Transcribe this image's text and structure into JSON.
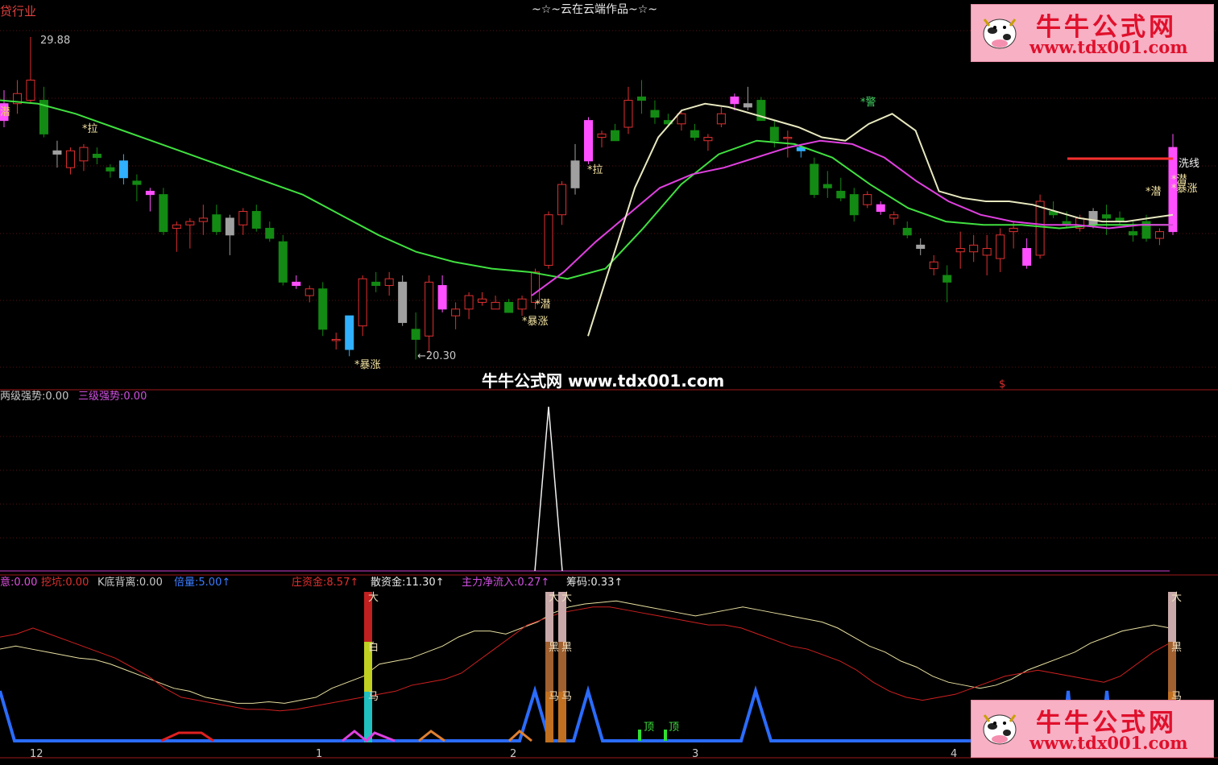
{
  "header": {
    "left_title": "贷行业",
    "center_title": "~☆~云在云端作品~☆~",
    "watermark": "牛牛公式网 www.tdx001.com"
  },
  "logo": {
    "cn": "牛牛公式网",
    "url": "www.tdx001.com"
  },
  "main_panel": {
    "price_high_label": "29.88",
    "price_low_label": "←20.30",
    "dollar_mark": "$",
    "annotations": [
      {
        "id": "qian-left",
        "text": "潜"
      },
      {
        "id": "la-1",
        "text": "*拉"
      },
      {
        "id": "la-2",
        "text": "*拉"
      },
      {
        "id": "baozhang-1",
        "text": "*暴涨"
      },
      {
        "id": "qian-2",
        "text": "*潜"
      },
      {
        "id": "baozhang-2",
        "text": "*暴涨"
      },
      {
        "id": "jing",
        "text": "*警"
      },
      {
        "id": "xixian",
        "text": "洗线"
      },
      {
        "id": "qian-3",
        "text": "*潜"
      },
      {
        "id": "qian-4",
        "text": "*潜"
      },
      {
        "id": "baozhang-3",
        "text": "*暴涨"
      }
    ]
  },
  "indicator1": {
    "items": [
      {
        "label": "两级强势:",
        "value": "0.00",
        "color": "#c8c8c8"
      },
      {
        "label": "三级强势:",
        "value": "0.00",
        "color": "#d050e0"
      }
    ]
  },
  "indicator2": {
    "items": [
      {
        "label": "意:",
        "value": "0.00",
        "color": "#e050e0"
      },
      {
        "label": "挖坑:",
        "value": "0.00",
        "color": "#e03030"
      },
      {
        "label": "K底背离:",
        "value": "0.00",
        "color": "#c8c8c8"
      },
      {
        "label": "倍量:",
        "value": "5.00↑",
        "color": "#3a7cff"
      },
      {
        "label": "庄资金:",
        "value": "8.57↑",
        "color": "#e03030"
      },
      {
        "label": "散资金:",
        "value": "11.30↑",
        "color": "#e8e8e8"
      },
      {
        "label": "主力净流入:",
        "value": "0.27↑",
        "color": "#d050e0"
      },
      {
        "label": "筹码:",
        "value": "0.33↑",
        "color": "#e8e8e8"
      }
    ],
    "bar_tags": [
      "大",
      "白",
      "马",
      "大",
      "大",
      "黑",
      "黑",
      "马",
      "马",
      "大",
      "黑",
      "马"
    ],
    "ding_tags": [
      "顶",
      "顶"
    ]
  },
  "x_axis": {
    "ticks": [
      "12",
      "1",
      "2",
      "3",
      "4"
    ]
  },
  "chart_data": {
    "type": "line",
    "title": "",
    "candles_ohlc": [
      [
        27.9,
        28.3,
        27.2,
        27.4
      ],
      [
        27.9,
        28.6,
        27.6,
        28.2
      ],
      [
        28.0,
        29.88,
        27.9,
        28.6
      ],
      [
        28.0,
        28.4,
        26.9,
        27.0
      ],
      [
        26.5,
        26.8,
        26.0,
        26.4
      ],
      [
        26.0,
        26.6,
        25.8,
        26.5
      ],
      [
        26.2,
        26.7,
        25.9,
        26.6
      ],
      [
        26.4,
        26.6,
        26.1,
        26.3
      ],
      [
        26.0,
        26.1,
        25.7,
        25.9
      ],
      [
        26.2,
        26.4,
        25.5,
        25.7
      ],
      [
        25.6,
        25.8,
        25.0,
        25.5
      ],
      [
        25.3,
        25.4,
        24.7,
        25.2
      ],
      [
        25.2,
        25.4,
        24.0,
        24.1
      ],
      [
        24.2,
        24.4,
        23.5,
        24.3
      ],
      [
        24.3,
        24.5,
        23.6,
        24.4
      ],
      [
        24.4,
        24.9,
        24.0,
        24.5
      ],
      [
        24.6,
        24.9,
        24.0,
        24.1
      ],
      [
        24.0,
        24.6,
        23.4,
        24.5
      ],
      [
        24.3,
        24.8,
        24.0,
        24.7
      ],
      [
        24.7,
        24.9,
        24.1,
        24.2
      ],
      [
        24.2,
        24.4,
        23.8,
        23.9
      ],
      [
        23.8,
        24.0,
        22.5,
        22.6
      ],
      [
        22.6,
        22.8,
        22.4,
        22.5
      ],
      [
        22.2,
        22.5,
        22.0,
        22.4
      ],
      [
        22.4,
        22.6,
        21.0,
        21.2
      ],
      [
        20.9,
        21.1,
        20.6,
        20.9
      ],
      [
        20.6,
        21.6,
        20.4,
        21.6
      ],
      [
        21.3,
        22.8,
        21.0,
        22.7
      ],
      [
        22.6,
        22.9,
        22.3,
        22.5
      ],
      [
        22.5,
        22.9,
        22.2,
        22.7
      ],
      [
        22.6,
        22.8,
        21.3,
        21.4
      ],
      [
        21.2,
        21.7,
        20.3,
        20.9
      ],
      [
        21.0,
        22.8,
        20.5,
        22.6
      ],
      [
        22.5,
        22.8,
        21.7,
        21.8
      ],
      [
        21.6,
        22.0,
        21.2,
        21.8
      ],
      [
        21.8,
        22.3,
        21.5,
        22.2
      ],
      [
        22.0,
        22.3,
        21.9,
        22.1
      ],
      [
        21.8,
        22.2,
        21.8,
        22.0
      ],
      [
        22.0,
        22.1,
        21.7,
        21.7
      ],
      [
        21.8,
        22.2,
        21.6,
        22.1
      ],
      [
        22.0,
        23.0,
        21.8,
        22.9
      ],
      [
        23.1,
        24.7,
        23.0,
        24.6
      ],
      [
        24.6,
        25.6,
        24.3,
        25.5
      ],
      [
        25.4,
        26.7,
        25.2,
        26.2
      ],
      [
        26.2,
        27.5,
        26.1,
        27.4
      ],
      [
        26.9,
        27.1,
        26.6,
        27.0
      ],
      [
        27.1,
        27.3,
        26.8,
        26.8
      ],
      [
        27.2,
        28.4,
        27.0,
        28.0
      ],
      [
        28.1,
        28.6,
        27.6,
        28.0
      ],
      [
        27.7,
        28.0,
        27.3,
        27.5
      ],
      [
        27.4,
        27.6,
        27.2,
        27.3
      ],
      [
        27.3,
        27.7,
        27.1,
        27.6
      ],
      [
        27.1,
        27.3,
        26.8,
        26.9
      ],
      [
        26.8,
        27.0,
        26.5,
        26.9
      ],
      [
        27.3,
        27.8,
        27.2,
        27.6
      ],
      [
        27.9,
        28.2,
        27.7,
        28.1
      ],
      [
        27.9,
        28.4,
        27.7,
        27.8
      ],
      [
        28.0,
        28.1,
        27.4,
        27.4
      ],
      [
        27.2,
        27.4,
        26.6,
        26.8
      ],
      [
        26.9,
        27.1,
        26.3,
        26.9
      ],
      [
        26.5,
        26.7,
        26.3,
        26.6
      ],
      [
        26.1,
        26.3,
        25.1,
        25.2
      ],
      [
        25.5,
        25.9,
        25.1,
        25.4
      ],
      [
        25.3,
        25.7,
        25.0,
        25.1
      ],
      [
        25.2,
        25.4,
        24.4,
        24.6
      ],
      [
        24.9,
        25.3,
        24.8,
        25.2
      ],
      [
        24.9,
        25.0,
        24.6,
        24.7
      ],
      [
        24.5,
        24.7,
        24.3,
        24.6
      ],
      [
        24.2,
        24.4,
        23.9,
        24.0
      ],
      [
        23.7,
        23.9,
        23.4,
        23.6
      ],
      [
        23.0,
        23.4,
        22.8,
        23.2
      ],
      [
        22.8,
        23.1,
        22.0,
        22.6
      ],
      [
        23.5,
        24.1,
        23.0,
        23.6
      ],
      [
        23.5,
        24.0,
        23.2,
        23.7
      ],
      [
        23.4,
        24.0,
        22.8,
        23.6
      ],
      [
        23.3,
        24.2,
        22.9,
        24.0
      ],
      [
        24.1,
        24.4,
        23.6,
        24.2
      ],
      [
        23.6,
        23.9,
        23.0,
        23.1
      ],
      [
        23.4,
        25.2,
        23.3,
        25.0
      ],
      [
        24.7,
        25.0,
        24.5,
        24.6
      ],
      [
        24.4,
        24.7,
        24.2,
        24.3
      ],
      [
        24.2,
        24.6,
        24.1,
        24.5
      ],
      [
        24.3,
        24.8,
        24.2,
        24.7
      ],
      [
        24.6,
        24.9,
        24.0,
        24.5
      ],
      [
        24.5,
        24.7,
        24.3,
        24.4
      ],
      [
        24.1,
        24.4,
        23.8,
        24.0
      ],
      [
        24.4,
        24.6,
        23.8,
        23.9
      ],
      [
        23.9,
        24.2,
        23.7,
        24.1
      ],
      [
        24.1,
        27.0,
        24.0,
        26.6
      ]
    ],
    "ma_green": [
      28.0,
      27.9,
      27.6,
      27.2,
      26.8,
      26.4,
      26.0,
      25.6,
      25.2,
      24.6,
      24.0,
      23.5,
      23.2,
      23.0,
      22.9,
      22.7,
      23.0,
      24.2,
      25.5,
      26.4,
      26.8,
      26.7,
      26.3,
      25.5,
      24.8,
      24.4,
      24.3,
      24.3,
      24.2,
      24.3,
      24.3,
      24.3
    ],
    "ma_magenta": [
      22.2,
      22.9,
      23.8,
      24.6,
      25.4,
      25.8,
      26.0,
      26.3,
      26.6,
      26.8,
      26.7,
      26.3,
      25.6,
      25.0,
      24.6,
      24.4,
      24.3,
      24.3,
      24.2,
      24.3,
      24.3
    ],
    "ma_white": [
      21.0,
      23.2,
      25.4,
      26.9,
      27.7,
      27.9,
      27.8,
      27.6,
      27.4,
      27.2,
      26.9,
      26.8,
      27.3,
      27.6,
      27.1,
      25.3,
      25.1,
      25.0,
      25.0,
      24.9,
      24.7,
      24.5,
      24.4,
      24.4,
      24.5,
      24.6
    ],
    "ylim": [
      19.5,
      30.5
    ],
    "pulse_peak": 1.0,
    "sanzijin": [
      62,
      64,
      62,
      60,
      58,
      56,
      55,
      52,
      48,
      44,
      40,
      36,
      34,
      30,
      28,
      26,
      26,
      27,
      26,
      28,
      30,
      36,
      40,
      44,
      52,
      54,
      56,
      60,
      64,
      70,
      74,
      74,
      72,
      76,
      80,
      86,
      90,
      92,
      93,
      94,
      92,
      90,
      88,
      86,
      84,
      86,
      88,
      90,
      88,
      86,
      84,
      82,
      80,
      76,
      70,
      64,
      60,
      54,
      50,
      44,
      40,
      38,
      36,
      38,
      42,
      48,
      52,
      56,
      60,
      66,
      70,
      74,
      76,
      78,
      76
    ],
    "zhuangzijin": [
      70,
      72,
      76,
      72,
      68,
      64,
      60,
      56,
      50,
      44,
      36,
      30,
      28,
      26,
      24,
      22,
      22,
      21,
      22,
      24,
      26,
      28,
      30,
      32,
      34,
      38,
      40,
      42,
      46,
      54,
      62,
      70,
      78,
      82,
      86,
      88,
      90,
      90,
      88,
      86,
      84,
      82,
      80,
      78,
      78,
      76,
      72,
      68,
      64,
      62,
      58,
      54,
      48,
      40,
      34,
      30,
      28,
      30,
      32,
      36,
      40,
      44,
      46,
      48,
      46,
      44,
      42,
      40,
      44,
      52,
      60,
      66
    ]
  }
}
